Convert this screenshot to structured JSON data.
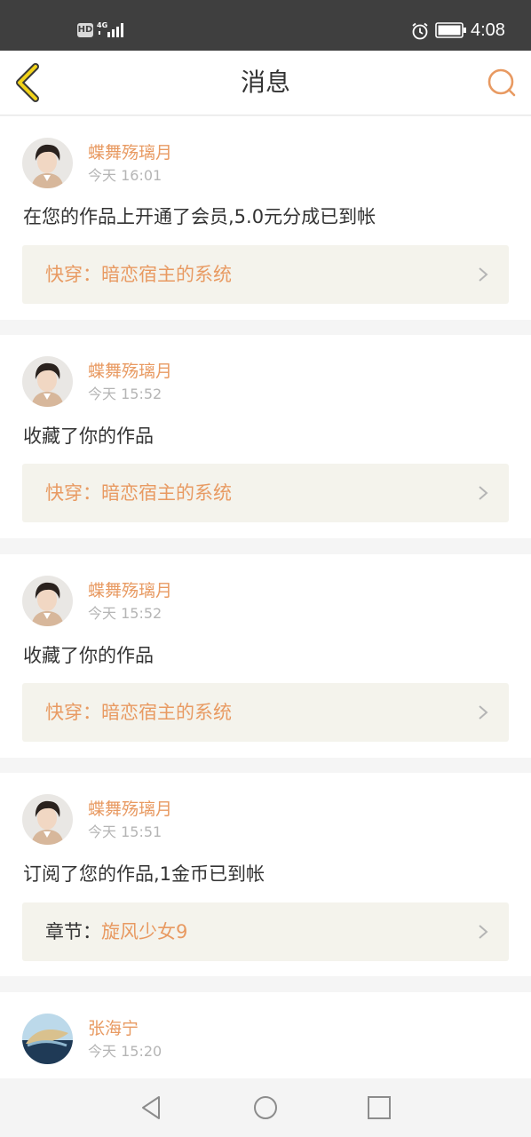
{
  "status_bar": {
    "hd_badge": "HD",
    "network": "4G",
    "time": "4:08",
    "icons": [
      "hd-icon",
      "signal-icon",
      "alarm-icon",
      "battery-icon"
    ]
  },
  "header": {
    "title": "消息",
    "back_icon": "chevron-left-icon",
    "search_icon": "search-icon",
    "accent_color": "#e89a62"
  },
  "messages": [
    {
      "user": "蝶舞殇璃月",
      "time": "今天 16:01",
      "text": "在您的作品上开通了会员,5.0元分成已到帐",
      "work_prefix": "快穿：",
      "work_title": "暗恋宿主的系统"
    },
    {
      "user": "蝶舞殇璃月",
      "time": "今天 15:52",
      "text": "收藏了你的作品",
      "work_prefix": "快穿：",
      "work_title": "暗恋宿主的系统"
    },
    {
      "user": "蝶舞殇璃月",
      "time": "今天 15:52",
      "text": "收藏了你的作品",
      "work_prefix": "快穿：",
      "work_title": "暗恋宿主的系统"
    },
    {
      "user": "蝶舞殇璃月",
      "time": "今天 15:51",
      "text": "订阅了您的作品,1金币已到帐",
      "work_prefix": "章节：",
      "work_title": "旋风少女9"
    },
    {
      "user": "张海宁",
      "time": "今天 15:20"
    }
  ],
  "navbar": {
    "icons": [
      "nav-back-icon",
      "nav-home-icon",
      "nav-recent-icon"
    ]
  }
}
